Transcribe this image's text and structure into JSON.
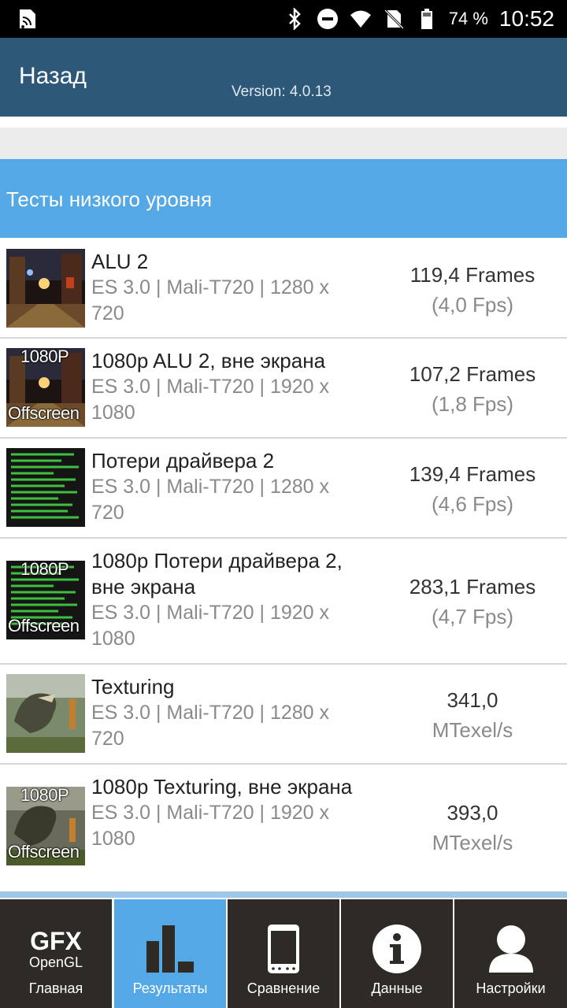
{
  "status_bar": {
    "battery_percent": "74 %",
    "time": "10:52",
    "icons": [
      "notification-icon",
      "bluetooth-icon",
      "do-not-disturb-icon",
      "wifi-icon",
      "no-sim-icon",
      "battery-icon"
    ]
  },
  "header": {
    "back_label": "Назад",
    "version": "Version: 4.0.13",
    "color": "#2d5878"
  },
  "section": {
    "title": "Тесты низкого уровня",
    "color": "#53a8e5"
  },
  "tests": [
    {
      "thumb": "alu-thumbnail",
      "title": "ALU 2",
      "subtitle": "ES 3.0 | Mali-T720 | 1280 x 720",
      "score": "119,4 Frames",
      "unit": "(4,0 Fps)"
    },
    {
      "thumb": "alu-offscreen-thumbnail",
      "badge_top": "1080P",
      "badge_bottom": "Offscreen",
      "title": "1080p ALU 2, вне экрана",
      "subtitle": "ES 3.0 | Mali-T720 | 1920 x 1080",
      "score": "107,2 Frames",
      "unit": "(1,8 Fps)"
    },
    {
      "thumb": "driver-overhead-thumbnail",
      "title": "Потери драйвера 2",
      "subtitle": "ES 3.0 | Mali-T720 | 1280 x 720",
      "score": "139,4 Frames",
      "unit": "(4,6 Fps)"
    },
    {
      "thumb": "driver-overhead-offscreen-thumbnail",
      "badge_top": "1080P",
      "badge_bottom": "Offscreen",
      "title": "1080p Потери драйвера 2, вне экрана",
      "subtitle": "ES 3.0 | Mali-T720 | 1920 x 1080",
      "score": "283,1 Frames",
      "unit": "(4,7 Fps)"
    },
    {
      "thumb": "texturing-thumbnail",
      "title": "Texturing",
      "subtitle": "ES 3.0 | Mali-T720 | 1280 x 720",
      "score": "341,0",
      "unit": "MTexel/s"
    },
    {
      "thumb": "texturing-offscreen-thumbnail",
      "badge_top": "1080P",
      "badge_bottom": "Offscreen",
      "title": "1080p Texturing, вне экрана",
      "subtitle": "ES 3.0 | Mali-T720 | 1920 x 1080",
      "score": "393,0",
      "unit": "MTexel/s"
    }
  ],
  "bottom_nav": {
    "logo_top": "GFX",
    "logo_bottom": "OpenGL",
    "items": [
      {
        "label": "Главная",
        "icon": "gfx-logo-icon",
        "active": false
      },
      {
        "label": "Результаты",
        "icon": "bar-chart-icon",
        "active": true
      },
      {
        "label": "Сравнение",
        "icon": "phone-icon",
        "active": false
      },
      {
        "label": "Данные",
        "icon": "info-icon",
        "active": false
      },
      {
        "label": "Настройки",
        "icon": "user-icon",
        "active": false
      }
    ]
  }
}
